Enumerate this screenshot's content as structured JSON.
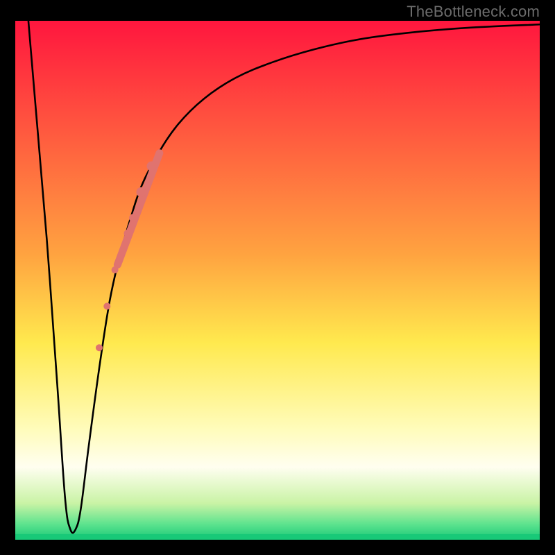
{
  "watermark": "TheBottleneck.com",
  "chart_data": {
    "type": "line",
    "title": "",
    "xlabel": "",
    "ylabel": "",
    "xlim": [
      0,
      100
    ],
    "ylim": [
      0,
      100
    ],
    "grid": false,
    "legend": false,
    "gradient_stops": [
      {
        "offset": 0,
        "color": "#ff163e"
      },
      {
        "offset": 45,
        "color": "#ffa340"
      },
      {
        "offset": 62,
        "color": "#ffe94e"
      },
      {
        "offset": 79,
        "color": "#fffcbd"
      },
      {
        "offset": 86,
        "color": "#fffef0"
      },
      {
        "offset": 93,
        "color": "#c9f3a5"
      },
      {
        "offset": 97,
        "color": "#5de38e"
      },
      {
        "offset": 100,
        "color": "#18c978"
      }
    ],
    "series": [
      {
        "name": "bottleneck-curve",
        "color": "#000000",
        "x": [
          2.5,
          4,
          6,
          8,
          9.5,
          10.5,
          11.5,
          12.5,
          14,
          16,
          18,
          20,
          22,
          24,
          27,
          31,
          36,
          42,
          49,
          57,
          66,
          76,
          87,
          100
        ],
        "values": [
          100,
          82,
          58,
          30,
          8,
          2,
          2,
          6,
          18,
          33,
          46,
          55,
          62,
          68,
          74,
          80,
          85,
          89,
          92,
          94.5,
          96.5,
          97.8,
          98.7,
          99.3
        ]
      }
    ],
    "markers": {
      "name": "highlighted-points",
      "color": "#e0736f",
      "points": [
        {
          "x": 21.5,
          "y": 59,
          "r": 6
        },
        {
          "x": 22.5,
          "y": 62,
          "r": 6
        },
        {
          "x": 24.0,
          "y": 67,
          "r": 7
        },
        {
          "x": 26.0,
          "y": 72,
          "r": 7
        },
        {
          "x": 19.0,
          "y": 52,
          "r": 5
        },
        {
          "x": 17.5,
          "y": 45,
          "r": 5
        },
        {
          "x": 16.0,
          "y": 37,
          "r": 5
        }
      ],
      "stroke_segment": {
        "x1": 19.5,
        "y1": 53,
        "x2": 27.5,
        "y2": 74.5,
        "width": 11
      }
    }
  }
}
